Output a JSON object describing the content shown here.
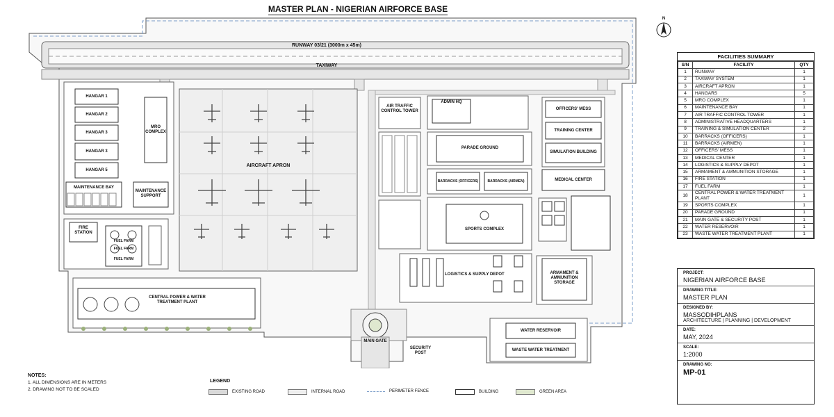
{
  "title": "MASTER PLAN - NIGERIAN AIRFORCE BASE",
  "north_label": "N",
  "plan_labels": {
    "runway": "RUNWAY 03/21 (3000m x 45m)",
    "taxiway": "TAXIWAY",
    "hangar_1": "HANGAR 1",
    "hangar_2": "HANGAR 2",
    "hangar_3a": "HANGAR 3",
    "hangar_3b": "HANGAR 3",
    "hangar_5": "HANGAR 5",
    "mro_complex": "MRO COMPLEX",
    "maintenance_bay": "MAINTENANCE BAY",
    "maintenance_support": "MAINTENANCE SUPPORT",
    "aircraft_apron": "AIRCRAFT APRON",
    "fire_station": "FIRE STATION",
    "fuel_farm_1": "FUEL FARM",
    "fuel_farm_2": "FUEL FARM",
    "fuel_farm_3": "FUEL FARM",
    "central_power": "CENTRAL POWER & WATER TREATMENT PLANT",
    "atc_tower": "AIR TRAFFIC CONTROL TOWER",
    "admin_hq": "ADMIN HQ",
    "officers_mess": "OFFICERS' MESS",
    "training_center": "TRAINING CENTER",
    "simulation_building": "SIMULATION BUILDING",
    "parade_ground": "PARADE GROUND",
    "barracks_officers": "BARRACKS (OFFICERS)",
    "barracks_airmen": "BARRACKS (AIRMEN)",
    "medical_center": "MEDICAL CENTER",
    "sports_complex": "SPORTS COMPLEX",
    "logistics_depot": "LOGISTICS & SUPPLY DEPOT",
    "armament_storage": "ARMAMENT & AMMUNITION STORAGE",
    "main_gate": "MAIN GATE",
    "security_post": "SECURITY POST",
    "water_reservoir": "WATER RESERVOIR",
    "waste_water": "WASTE WATER TREATMENT"
  },
  "summary": {
    "heading": "FACILITIES SUMMARY",
    "col_sn": "S/N",
    "col_facility": "FACILITY",
    "col_qty": "QTY",
    "rows": [
      {
        "sn": "1",
        "facility": "RUNWAY",
        "qty": "1"
      },
      {
        "sn": "2",
        "facility": "TAXIWAY SYSTEM",
        "qty": "1"
      },
      {
        "sn": "3",
        "facility": "AIRCRAFT APRON",
        "qty": "1"
      },
      {
        "sn": "4",
        "facility": "HANGARS",
        "qty": "5"
      },
      {
        "sn": "5",
        "facility": "MRO COMPLEX",
        "qty": "1"
      },
      {
        "sn": "6",
        "facility": "MAINTENANCE BAY",
        "qty": "1"
      },
      {
        "sn": "7",
        "facility": "AIR TRAFFIC CONTROL TOWER",
        "qty": "1"
      },
      {
        "sn": "8",
        "facility": "ADMINISTRATIVE HEADQUARTERS",
        "qty": "1"
      },
      {
        "sn": "9",
        "facility": "TRAINING & SIMULATION CENTER",
        "qty": "2"
      },
      {
        "sn": "10",
        "facility": "BARRACKS (OFFICERS)",
        "qty": "1"
      },
      {
        "sn": "11",
        "facility": "BARRACKS (AIRMEN)",
        "qty": "1"
      },
      {
        "sn": "12",
        "facility": "OFFICERS' MESS",
        "qty": "1"
      },
      {
        "sn": "13",
        "facility": "MEDICAL CENTER",
        "qty": "1"
      },
      {
        "sn": "14",
        "facility": "LOGISTICS & SUPPLY DEPOT",
        "qty": "1"
      },
      {
        "sn": "15",
        "facility": "ARMAMENT & AMMUNITION STORAGE",
        "qty": "1"
      },
      {
        "sn": "16",
        "facility": "FIRE STATION",
        "qty": "1"
      },
      {
        "sn": "17",
        "facility": "FUEL FARM",
        "qty": "1"
      },
      {
        "sn": "18",
        "facility": "CENTRAL POWER & WATER TREATMENT PLANT",
        "qty": "1"
      },
      {
        "sn": "19",
        "facility": "SPORTS COMPLEX",
        "qty": "1"
      },
      {
        "sn": "20",
        "facility": "PARADE GROUND",
        "qty": "1"
      },
      {
        "sn": "21",
        "facility": "MAIN GATE & SECURITY POST",
        "qty": "1"
      },
      {
        "sn": "22",
        "facility": "WATER RESERVOIR",
        "qty": "1"
      },
      {
        "sn": "23",
        "facility": "WASTE WATER TREATMENT PLANT",
        "qty": "1"
      }
    ]
  },
  "title_block": {
    "project_label": "PROJECT:",
    "project": "NIGERIAN AIRFORCE BASE",
    "drawing_title_label": "DRAWING TITLE:",
    "drawing_title": "MASTER PLAN",
    "designed_by_label": "DESIGNED BY:",
    "designer": "MASSODIHPLANS",
    "designer_tagline": "ARCHITECTURE | PLANNING | DEVELOPMENT",
    "date_label": "DATE:",
    "date": "MAY, 2024",
    "scale_label": "SCALE:",
    "scale": "1:2000",
    "drawing_no_label": "DRAWING NO:",
    "drawing_no": "MP-01"
  },
  "notes": {
    "heading": "NOTES:",
    "items": [
      "1.  ALL DIMENSIONS ARE IN METERS",
      "2.  DRAWING NOT TO BE SCALED"
    ]
  },
  "legend": {
    "heading": "LEGEND",
    "items": [
      {
        "label": "EXISTING ROAD",
        "color": "#d9d9d9"
      },
      {
        "label": "INTERNAL ROAD",
        "color": "#eeeeee"
      },
      {
        "label": "PERIMETER FENCE",
        "color": "#7a9cc9"
      },
      {
        "label": "BUILDING",
        "color": "#ffffff"
      },
      {
        "label": "GREEN AREA",
        "color": "#dfe8cf"
      }
    ]
  },
  "colors": {
    "road": "#e6e6e6",
    "apron": "#efefef",
    "line": "#555555",
    "fence": "#7a9cc9",
    "tree": "#9bb07a"
  }
}
